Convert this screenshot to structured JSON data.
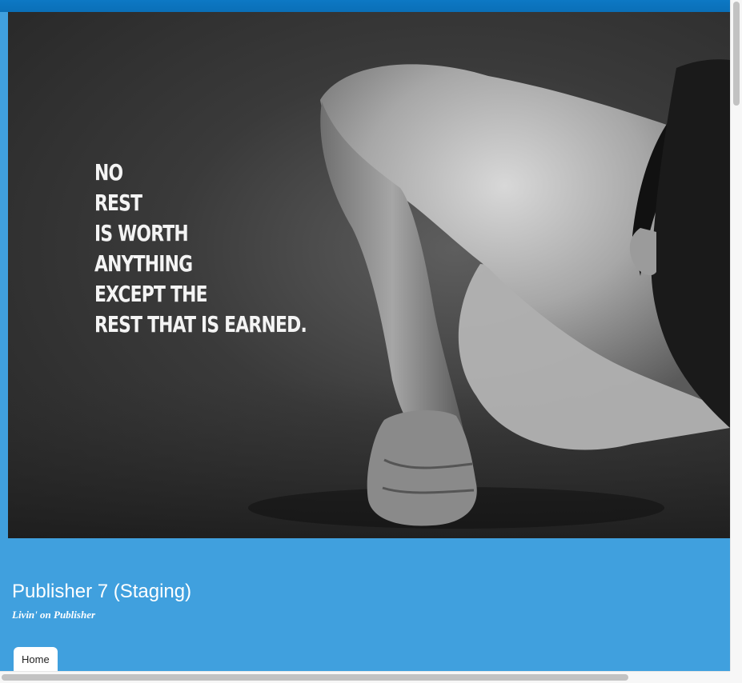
{
  "colors": {
    "header_blue": "#40a0de",
    "top_strip": "#0a6fb7",
    "tab_background": "#ffffff"
  },
  "hero": {
    "image": "black-and-white photo of a muscular man doing a knuckle push-up",
    "quote_lines": [
      "NO",
      "REST",
      "IS WORTH",
      "ANYTHING",
      "EXCEPT THE",
      "REST THAT IS EARNED."
    ]
  },
  "site": {
    "title": "Publisher 7 (Staging)",
    "tagline": "Livin' on Publisher"
  },
  "nav": {
    "items": [
      {
        "label": "Home"
      }
    ]
  }
}
